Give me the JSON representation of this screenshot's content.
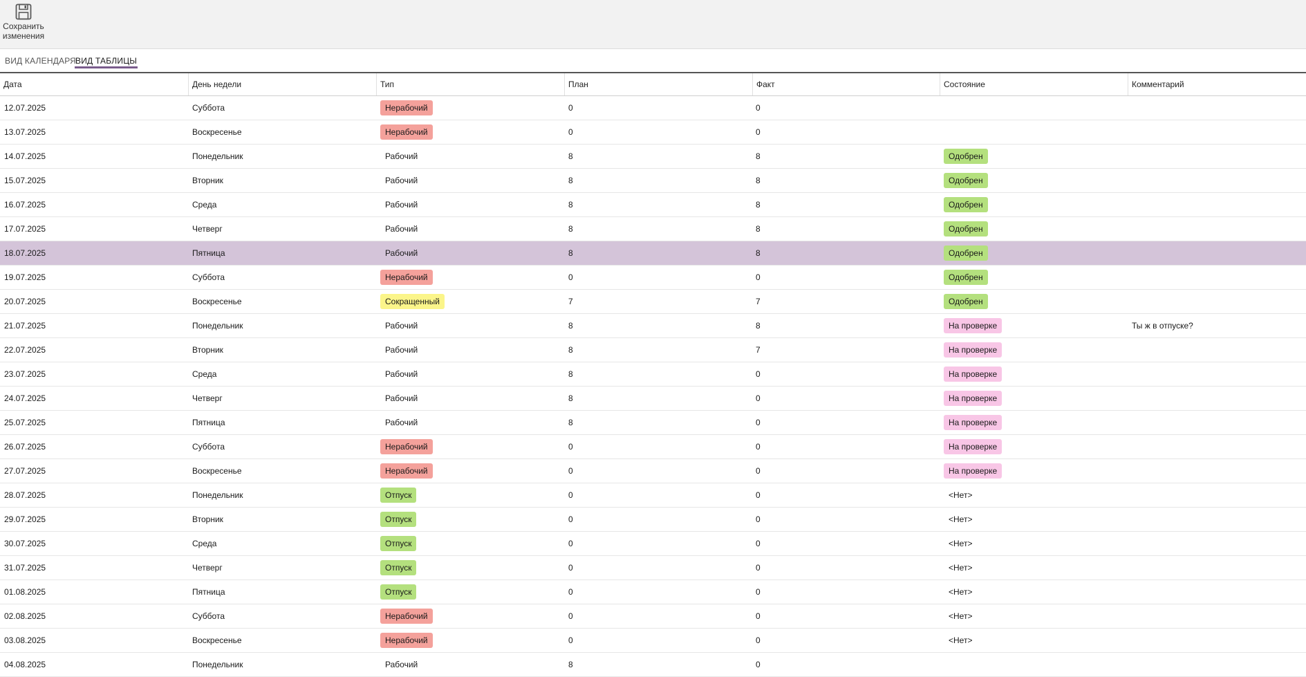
{
  "toolbar": {
    "save_label": "Сохранить изменения"
  },
  "tabs": [
    {
      "label": "ВИД КАЛЕНДАРЯ",
      "active": false
    },
    {
      "label": "ВИД ТАБЛИЦЫ",
      "active": true
    }
  ],
  "columns": [
    "Дата",
    "День недели",
    "Тип",
    "План",
    "Факт",
    "Состояние",
    "Комментарий"
  ],
  "colors": {
    "selected_row": "#d4c4d9",
    "nonworking": "#f4a19b",
    "shortened": "#fbf58a",
    "vacation": "#b4e07e",
    "approved": "#b4e07e",
    "review": "#f8c6e6",
    "tab_accent": "#7a5c8c"
  },
  "rows": [
    {
      "date": "12.07.2025",
      "weekday": "Суббота",
      "type": "Нерабочий",
      "plan": "0",
      "fact": "0",
      "state": "",
      "comment": ""
    },
    {
      "date": "13.07.2025",
      "weekday": "Воскресенье",
      "type": "Нерабочий",
      "plan": "0",
      "fact": "0",
      "state": "",
      "comment": ""
    },
    {
      "date": "14.07.2025",
      "weekday": "Понедельник",
      "type": "Рабочий",
      "plan": "8",
      "fact": "8",
      "state": "Одобрен",
      "comment": ""
    },
    {
      "date": "15.07.2025",
      "weekday": "Вторник",
      "type": "Рабочий",
      "plan": "8",
      "fact": "8",
      "state": "Одобрен",
      "comment": ""
    },
    {
      "date": "16.07.2025",
      "weekday": "Среда",
      "type": "Рабочий",
      "plan": "8",
      "fact": "8",
      "state": "Одобрен",
      "comment": ""
    },
    {
      "date": "17.07.2025",
      "weekday": "Четверг",
      "type": "Рабочий",
      "plan": "8",
      "fact": "8",
      "state": "Одобрен",
      "comment": ""
    },
    {
      "date": "18.07.2025",
      "weekday": "Пятница",
      "type": "Рабочий",
      "plan": "8",
      "fact": "8",
      "state": "Одобрен",
      "comment": "",
      "selected": true
    },
    {
      "date": "19.07.2025",
      "weekday": "Суббота",
      "type": "Нерабочий",
      "plan": "0",
      "fact": "0",
      "state": "Одобрен",
      "comment": ""
    },
    {
      "date": "20.07.2025",
      "weekday": "Воскресенье",
      "type": "Сокращенный",
      "plan": "7",
      "fact": "7",
      "state": "Одобрен",
      "comment": ""
    },
    {
      "date": "21.07.2025",
      "weekday": "Понедельник",
      "type": "Рабочий",
      "plan": "8",
      "fact": "8",
      "state": "На проверке",
      "comment": "Ты ж в отпуске?"
    },
    {
      "date": "22.07.2025",
      "weekday": "Вторник",
      "type": "Рабочий",
      "plan": "8",
      "fact": "7",
      "state": "На проверке",
      "comment": ""
    },
    {
      "date": "23.07.2025",
      "weekday": "Среда",
      "type": "Рабочий",
      "plan": "8",
      "fact": "0",
      "state": "На проверке",
      "comment": ""
    },
    {
      "date": "24.07.2025",
      "weekday": "Четверг",
      "type": "Рабочий",
      "plan": "8",
      "fact": "0",
      "state": "На проверке",
      "comment": ""
    },
    {
      "date": "25.07.2025",
      "weekday": "Пятница",
      "type": "Рабочий",
      "plan": "8",
      "fact": "0",
      "state": "На проверке",
      "comment": ""
    },
    {
      "date": "26.07.2025",
      "weekday": "Суббота",
      "type": "Нерабочий",
      "plan": "0",
      "fact": "0",
      "state": "На проверке",
      "comment": ""
    },
    {
      "date": "27.07.2025",
      "weekday": "Воскресенье",
      "type": "Нерабочий",
      "plan": "0",
      "fact": "0",
      "state": "На проверке",
      "comment": ""
    },
    {
      "date": "28.07.2025",
      "weekday": "Понедельник",
      "type": "Отпуск",
      "plan": "0",
      "fact": "0",
      "state": "<Нет>",
      "comment": ""
    },
    {
      "date": "29.07.2025",
      "weekday": "Вторник",
      "type": "Отпуск",
      "plan": "0",
      "fact": "0",
      "state": "<Нет>",
      "comment": ""
    },
    {
      "date": "30.07.2025",
      "weekday": "Среда",
      "type": "Отпуск",
      "plan": "0",
      "fact": "0",
      "state": "<Нет>",
      "comment": ""
    },
    {
      "date": "31.07.2025",
      "weekday": "Четверг",
      "type": "Отпуск",
      "plan": "0",
      "fact": "0",
      "state": "<Нет>",
      "comment": ""
    },
    {
      "date": "01.08.2025",
      "weekday": "Пятница",
      "type": "Отпуск",
      "plan": "0",
      "fact": "0",
      "state": "<Нет>",
      "comment": ""
    },
    {
      "date": "02.08.2025",
      "weekday": "Суббота",
      "type": "Нерабочий",
      "plan": "0",
      "fact": "0",
      "state": "<Нет>",
      "comment": ""
    },
    {
      "date": "03.08.2025",
      "weekday": "Воскресенье",
      "type": "Нерабочий",
      "plan": "0",
      "fact": "0",
      "state": "<Нет>",
      "comment": ""
    },
    {
      "date": "04.08.2025",
      "weekday": "Понедельник",
      "type": "Рабочий",
      "plan": "8",
      "fact": "0",
      "state": "",
      "comment": ""
    }
  ]
}
